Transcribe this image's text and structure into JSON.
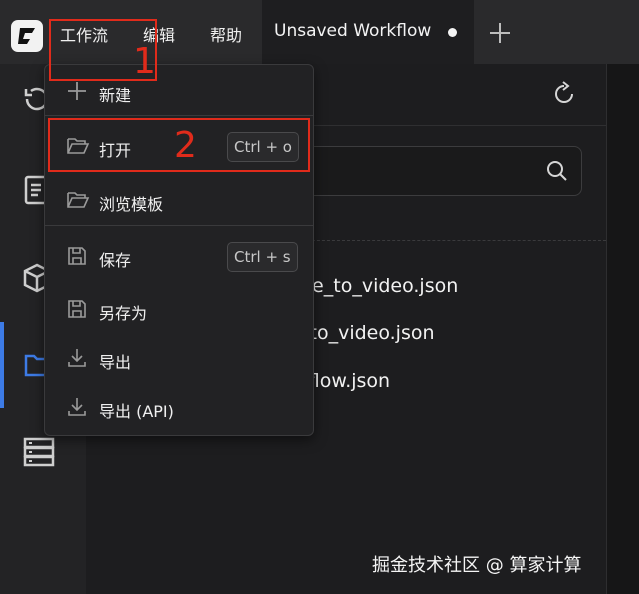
{
  "menubar": {
    "items": [
      "工作流",
      "编辑",
      "帮助"
    ]
  },
  "tab": {
    "title": "Unsaved Workflow"
  },
  "dropdown": {
    "items": [
      {
        "label": "新建",
        "icon": "plus-icon"
      },
      {
        "label": "打开",
        "icon": "folder-open-icon",
        "shortcut": "Ctrl + o"
      },
      {
        "label": "浏览模板",
        "icon": "folder-open-icon"
      },
      {
        "label": "保存",
        "icon": "save-icon",
        "shortcut": "Ctrl + s"
      },
      {
        "label": "另存为",
        "icon": "save-icon"
      },
      {
        "label": "导出",
        "icon": "download-icon"
      },
      {
        "label": "导出 (API)",
        "icon": "download-icon"
      }
    ]
  },
  "files": [
    "ge_to_video.json",
    "_to_video.json",
    "rflow.json"
  ],
  "annotations": {
    "step1": "1",
    "step2": "2",
    "color": "#e02b1b"
  },
  "watermark": "掘金技术社区 @ 算家计算",
  "colors": {
    "accent": "#3d7be6",
    "background": "#1b1b1d"
  }
}
